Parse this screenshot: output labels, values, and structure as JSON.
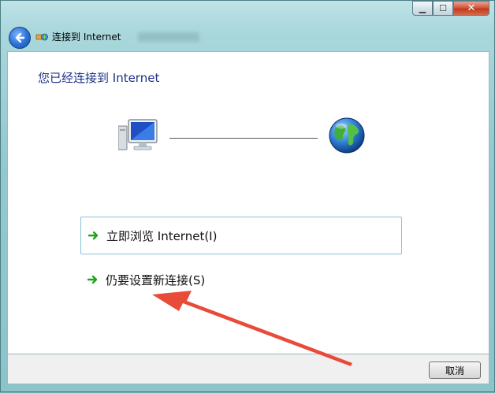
{
  "window": {
    "title": "连接到 Internet",
    "caption_buttons": {
      "minimize": "▁",
      "maximize": "☐",
      "close": "✕"
    }
  },
  "main": {
    "heading": "您已经连接到 Internet",
    "options": [
      {
        "label": "立即浏览 Internet(I)",
        "icon": "green-arrow-icon"
      },
      {
        "label": "仍要设置新连接(S)",
        "icon": "green-arrow-icon"
      }
    ]
  },
  "footer": {
    "cancel_label": "取消"
  },
  "colors": {
    "heading": "#1e3287",
    "option_border": "#88c4d6",
    "annotation_arrow": "#e8412f"
  }
}
